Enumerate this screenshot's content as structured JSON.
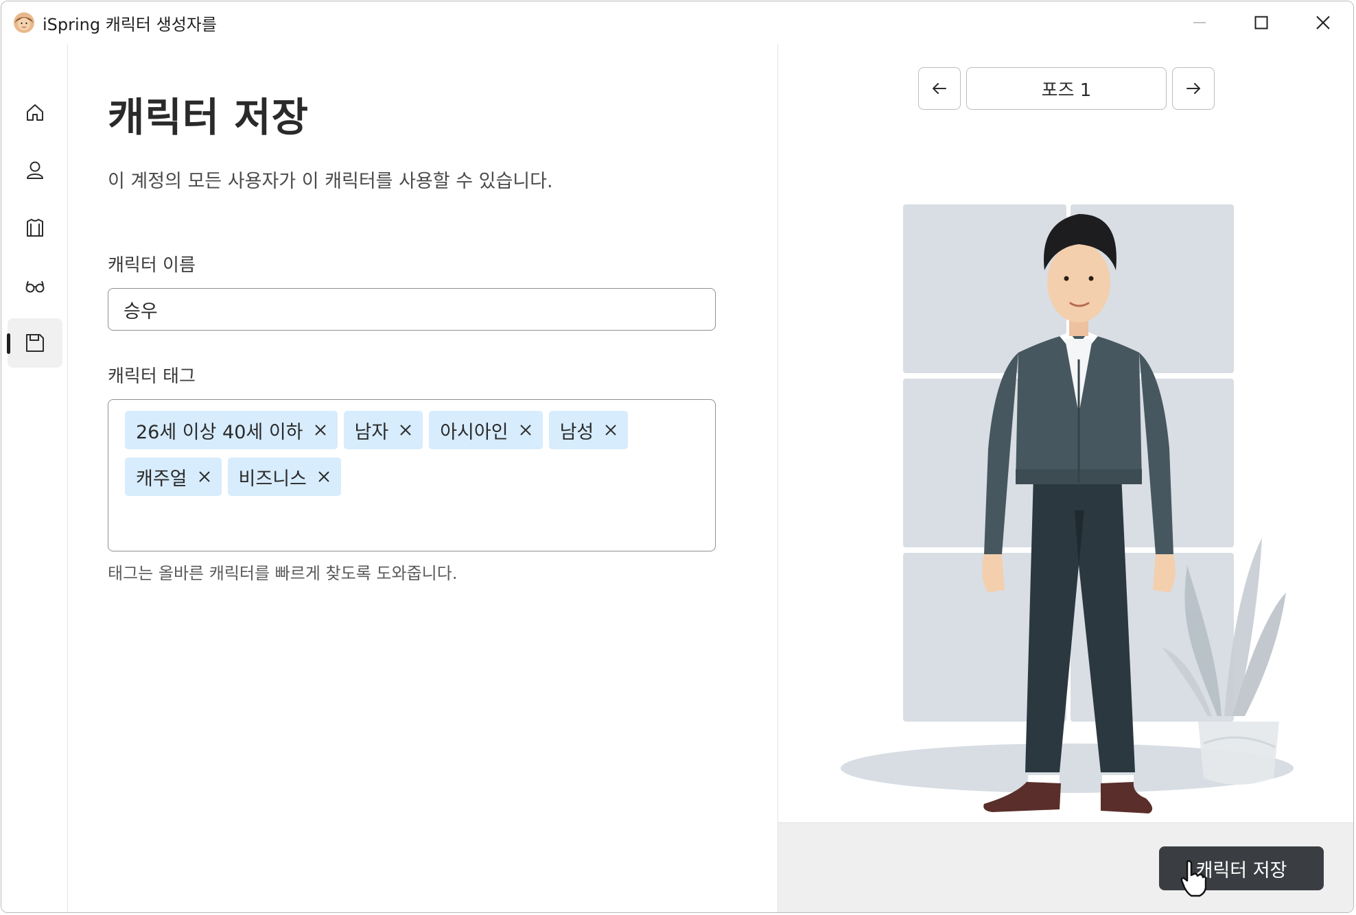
{
  "window": {
    "title": "iSpring 캐릭터 생성자를",
    "icon": "character-face-icon",
    "controls": [
      "minimize-icon",
      "maximize-icon",
      "close-icon"
    ]
  },
  "nav": {
    "items": [
      {
        "name": "home",
        "icon": "home-icon"
      },
      {
        "name": "character",
        "icon": "person-icon"
      },
      {
        "name": "clothing",
        "icon": "shirt-icon"
      },
      {
        "name": "accessories",
        "icon": "glasses-icon"
      },
      {
        "name": "save",
        "icon": "save-icon",
        "active": true
      }
    ]
  },
  "form": {
    "title": "캐릭터 저장",
    "subtitle": "이 계정의 모든 사용자가 이 캐릭터를 사용할 수 있습니다.",
    "name_label": "캐릭터 이름",
    "name_value": "승우",
    "tags_label": "캐릭터 태그",
    "tags": [
      "26세 이상 40세 이하",
      "남자",
      "아시아인",
      "남성",
      "캐주얼",
      "비즈니스"
    ],
    "tags_hint": "태그는 올바른 캐릭터를 빠르게 찾도록 도와줍니다."
  },
  "preview": {
    "pose_label": "포즈 1",
    "prev_icon": "arrow-left-icon",
    "next_icon": "arrow-right-icon",
    "save_button": "캐릭터 저장"
  },
  "colors": {
    "accent_dark": "#3a3e42",
    "tag_background": "#d7ecfc",
    "scene_panel": "#d9dee4",
    "cardigan": "#46575f",
    "trousers": "#2b3840"
  }
}
